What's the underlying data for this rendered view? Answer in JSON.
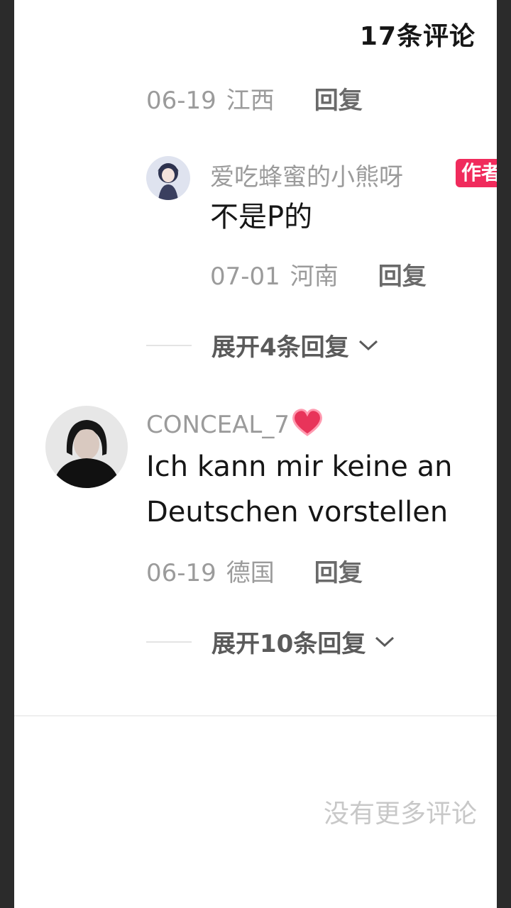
{
  "header": {
    "title": "17条评论"
  },
  "thread1": {
    "date": "06-19",
    "location": "江西",
    "reply_label": "回复"
  },
  "thread1_reply": {
    "username": "爱吃蜂蜜的小熊呀",
    "badge": "作者",
    "text": "不是P的",
    "date": "07-01",
    "location": "河南",
    "reply_label": "回复"
  },
  "thread1_expand": {
    "label": "展开4条回复"
  },
  "comment2": {
    "username": "CONCEAL_7",
    "heart_icon": "heart-icon",
    "text_line1": "Ich kann mir keine an",
    "text_line2": "Deutschen vorstellen",
    "date": "06-19",
    "location": "德国",
    "reply_label": "回复"
  },
  "comment2_expand": {
    "label": "展开10条回复"
  },
  "footer": {
    "text": "没有更多评论"
  },
  "colors": {
    "badge": "#f02b5c",
    "heart": "#e8345a",
    "text": "#161616",
    "meta": "#9b9b9b"
  }
}
